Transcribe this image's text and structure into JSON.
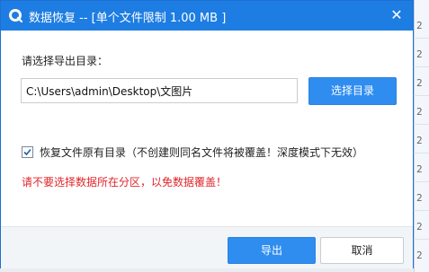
{
  "dialog": {
    "title": "数据恢复  -- [单个文件限制 1.00 MB ]",
    "close_icon": "close-icon",
    "app_icon": "recovery-app-icon",
    "colors": {
      "titlebar": "#1e7de2",
      "primary_button": "#2f8df0",
      "warning_text": "#e0262b"
    }
  },
  "export": {
    "label": "请选择导出目录：",
    "path_value": "C:\\Users\\admin\\Desktop\\文图片",
    "browse_label": "选择目录"
  },
  "options": {
    "keep_structure_label": "恢复文件原有目录（不创建则同名文件将被覆盖！深度模式下无效）",
    "keep_structure_checked": true
  },
  "warning": "请不要选择数据所在分区，以免数据覆盖！",
  "footer": {
    "export_label": "导出",
    "cancel_label": "取消"
  },
  "background_window": {
    "row_marks": [
      "2",
      "2",
      "2",
      "2",
      "2",
      "2",
      "2",
      "2",
      "2",
      "2",
      "2"
    ]
  }
}
